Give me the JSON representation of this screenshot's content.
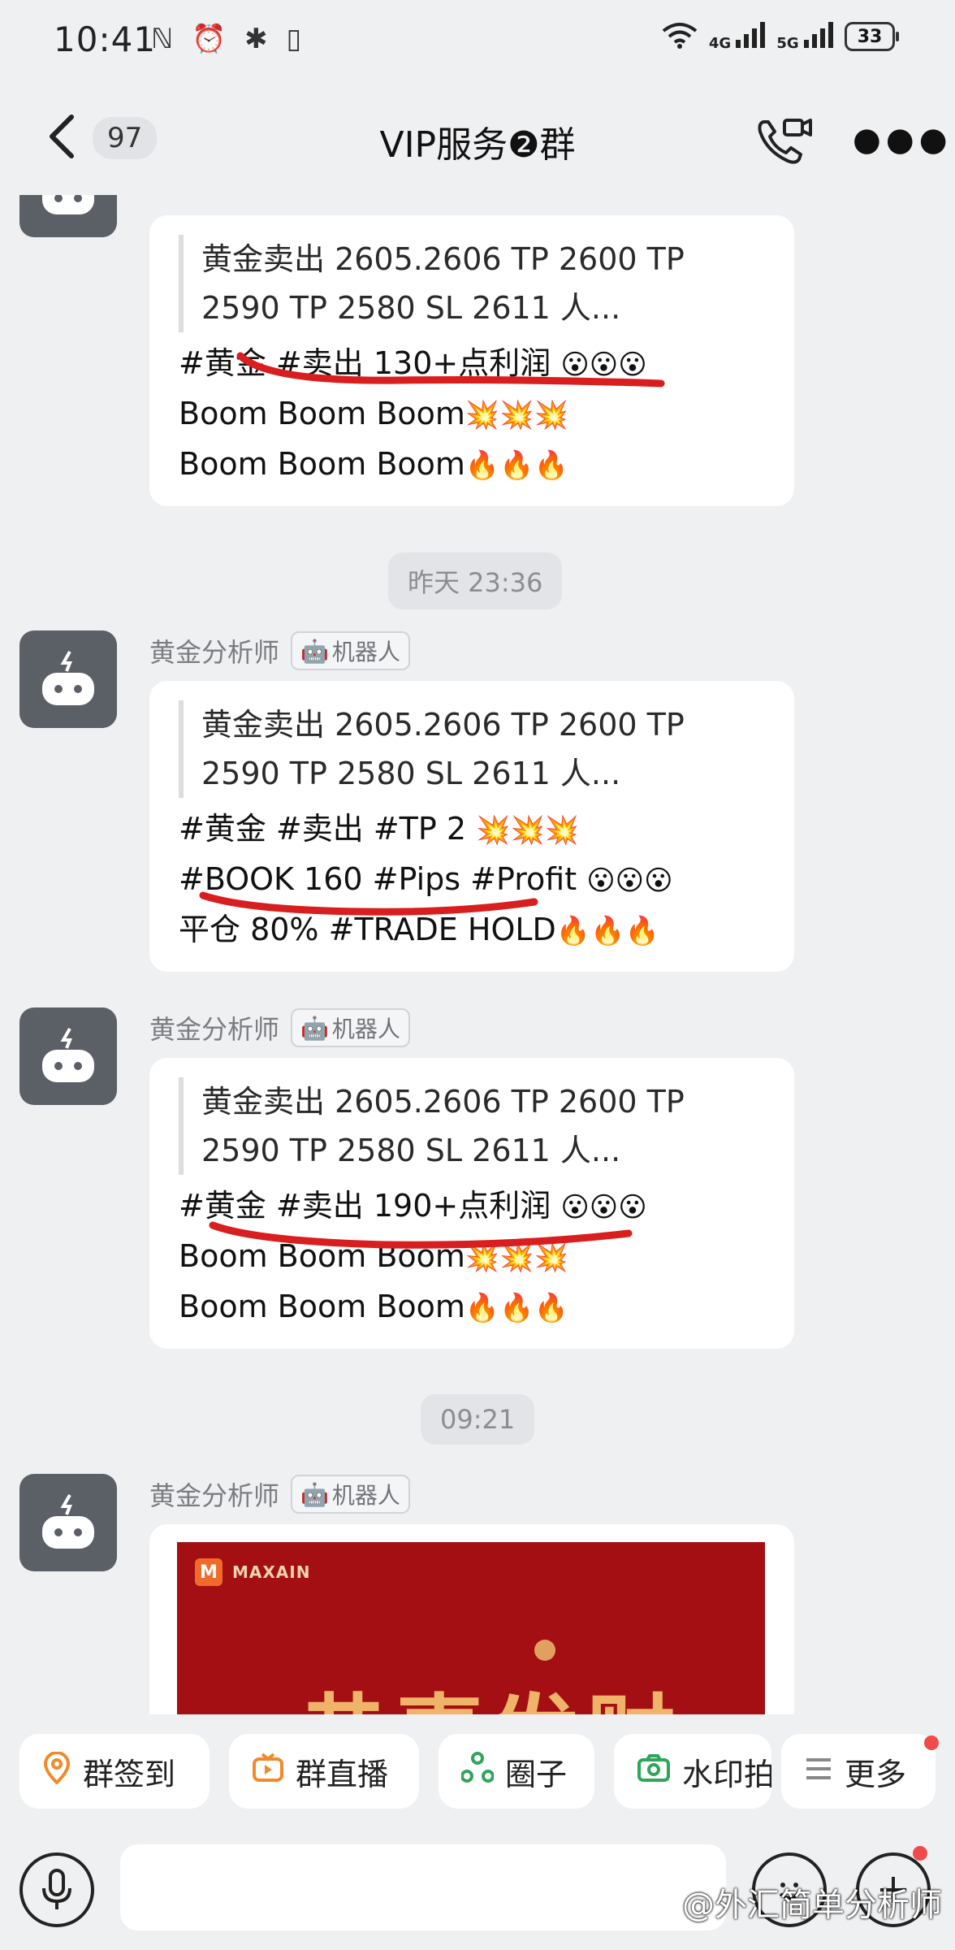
{
  "status_bar": {
    "time": "10:41",
    "signal_1": "4G",
    "signal_2": "5G",
    "battery": "33"
  },
  "header": {
    "unread_count": "97",
    "title": "VIP服务❷群"
  },
  "messages": [
    {
      "quote_1": "黄金卖出 2605.2606  TP 2600 TP",
      "quote_2": "2590 TP 2580  SL 2611 人...",
      "line_1": "#黄金 #卖出 130+点利润",
      "line_1_emoji": "😮😮😮",
      "line_2": "Boom Boom Boom",
      "line_2_emoji": "💥💥💥",
      "line_3": "Boom Boom Boom",
      "line_3_emoji": "🔥🔥🔥"
    },
    {
      "timestamp": "昨天 23:36",
      "sender": "黄金分析师",
      "tag": "机器人",
      "quote_1": "黄金卖出 2605.2606  TP 2600 TP",
      "quote_2": "2590 TP 2580  SL 2611 人...",
      "line_1": "#黄金 #卖出 #TP 2",
      "line_1_emoji": "💥💥💥",
      "line_2": "#BOOK 160 #Pips #Profit",
      "line_2_emoji": "😮😮😮",
      "line_3": "平仓 80% #TRADE HOLD",
      "line_3_emoji": "🔥🔥🔥"
    },
    {
      "sender": "黄金分析师",
      "tag": "机器人",
      "quote_1": "黄金卖出 2605.2606  TP 2600 TP",
      "quote_2": "2590 TP 2580  SL 2611 人...",
      "line_1": "#黄金 #卖出 190+点利润",
      "line_1_emoji": "😮😮😮",
      "line_2": "Boom Boom Boom",
      "line_2_emoji": "💥💥💥",
      "line_3": "Boom Boom Boom",
      "line_3_emoji": "🔥🔥🔥"
    },
    {
      "timestamp": "09:21",
      "sender": "黄金分析师",
      "tag": "机器人",
      "poster_brand": "MAXAIN",
      "poster_mark": "M",
      "poster_text": "恭喜发财"
    }
  ],
  "quick_actions": [
    {
      "label": "群签到",
      "icon": "location-pin-icon"
    },
    {
      "label": "群直播",
      "icon": "live-tv-icon"
    },
    {
      "label": "圈子",
      "icon": "circle-share-icon"
    },
    {
      "label": "水印拍",
      "icon": "camera-icon"
    },
    {
      "label": "更多",
      "icon": "menu-lines-icon"
    }
  ],
  "watermark": "@外汇简单分析师",
  "colors": {
    "background": "#eff0f2",
    "bubble": "#ffffff",
    "avatar": "#5b5f66",
    "underline": "#d81e1e",
    "poster": "#a30f12",
    "notification_dot": "#f04a4a"
  }
}
